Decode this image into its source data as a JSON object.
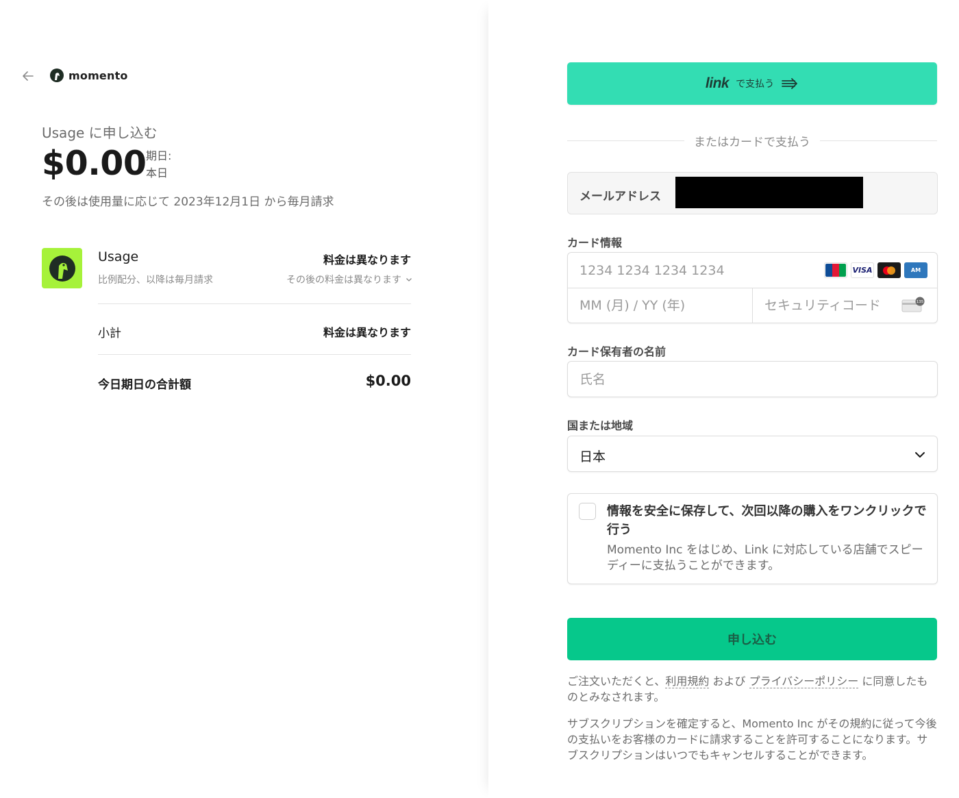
{
  "header": {
    "brand_name": "momento"
  },
  "summary": {
    "subscribe_title": "Usage に申し込む",
    "amount": "$0.00",
    "due_label": "期日:",
    "due_value": "本日",
    "billing_note": "その後は使用量に応じて 2023年12月1日 から毎月請求"
  },
  "line_item": {
    "name": "Usage",
    "description": "比例配分、以降は毎月請求",
    "price": "料金は異なります",
    "price_sub": "その後の料金は異なります"
  },
  "totals": {
    "subtotal_label": "小計",
    "subtotal_value": "料金は異なります",
    "total_label": "今日期日の合計額",
    "total_value": "$0.00"
  },
  "payment": {
    "link_logo": "link",
    "link_label": "で支払う",
    "or_card": "またはカードで支払う",
    "email_label": "メールアドレス",
    "card_label": "カード情報",
    "card_number_placeholder": "1234 1234 1234 1234",
    "card_expiry_placeholder": "MM (月) / YY (年)",
    "card_cvc_placeholder": "セキュリティコード",
    "card_brands": [
      "JCB",
      "VISA",
      "Mastercard",
      "AMEX"
    ],
    "cvc_badge": "135",
    "name_label": "カード保有者の名前",
    "name_placeholder": "氏名",
    "country_label": "国または地域",
    "country_value": "日本",
    "save_title": "情報を安全に保存して、次回以降の購入をワンクリックで行う",
    "save_desc": "Momento Inc をはじめ、Link に対応している店舗でスピーディーに支払うことができます。",
    "submit_label": "申し込む",
    "terms_prefix": "ご注文いただくと、",
    "terms_link": "利用規約",
    "terms_and": " および ",
    "privacy_link": "プライバシーポリシー",
    "terms_suffix": " に同意したものとみなされます。",
    "subscription_note": "サブスクリプションを確定すると、Momento Inc がその規約に従って今後の支払いをお客様のカードに請求することを許可することになります。サブスクリプションはいつでもキャンセルすることができます。"
  },
  "colors": {
    "link_button": "#33ddb3",
    "submit_button": "#06c88b",
    "product_icon_bg": "#a6f23a"
  }
}
